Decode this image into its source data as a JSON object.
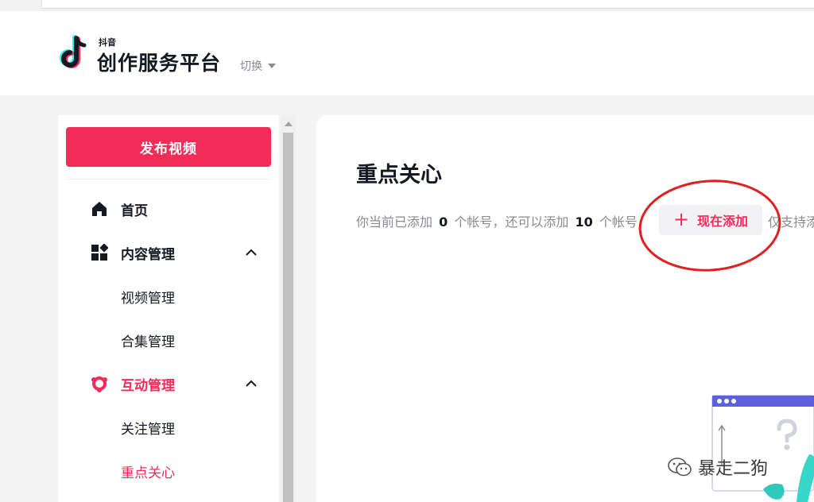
{
  "header": {
    "logo_small": "抖音",
    "logo_main": "创作服务平台",
    "switch_label": "切换",
    "logo_icon": "tiktok-note-icon",
    "switch_icon": "caret-down-icon"
  },
  "sidebar": {
    "publish_label": "发布视频",
    "items": [
      {
        "label": "首页",
        "icon": "home-icon"
      },
      {
        "label": "内容管理",
        "icon": "grid-icon",
        "expanded": true,
        "children": [
          "视频管理",
          "合集管理"
        ]
      },
      {
        "label": "互动管理",
        "icon": "interaction-icon",
        "expanded": true,
        "children": [
          "关注管理",
          "重点关心"
        ]
      }
    ],
    "active_item": "重点关心"
  },
  "main": {
    "title": "重点关心",
    "info_prefix": "你当前已添加",
    "added_count": "0",
    "info_mid": "个帐号，还可以添加",
    "remaining_count": "10",
    "info_suffix": "个帐号",
    "add_button_icon": "+",
    "add_button_label": "现在添加",
    "after_text": "仅支持添"
  },
  "watermark": {
    "text": "暴走二狗",
    "icon": "wechat-icon"
  },
  "colors": {
    "accent": "#f32c58",
    "annotation": "#e02020",
    "text": "#161823",
    "muted": "#8a8b91"
  }
}
